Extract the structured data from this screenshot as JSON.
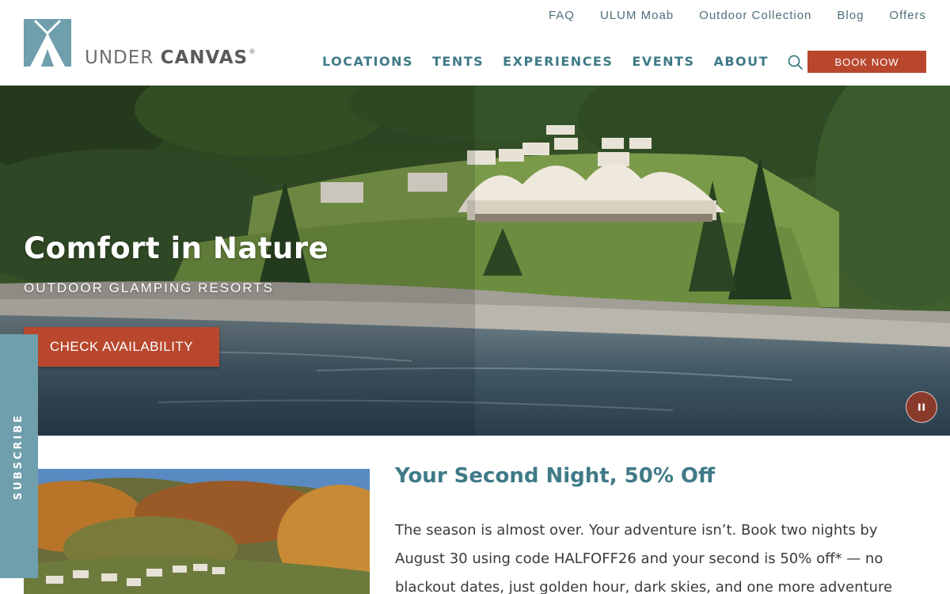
{
  "brand": {
    "name_part1": "UNDER ",
    "name_part2": "CANVAS",
    "mark": "®",
    "colors": {
      "teal": "#3f7a87",
      "slate": "#6f9eac",
      "rust": "#b9472e"
    }
  },
  "utility_nav": [
    {
      "label": "FAQ"
    },
    {
      "label": "ULUM Moab"
    },
    {
      "label": "Outdoor Collection"
    },
    {
      "label": "Blog"
    },
    {
      "label": "Offers"
    }
  ],
  "main_nav": [
    {
      "label": "LOCATIONS"
    },
    {
      "label": "TENTS"
    },
    {
      "label": "EXPERIENCES"
    },
    {
      "label": "EVENTS"
    },
    {
      "label": "ABOUT"
    }
  ],
  "icons": {
    "search": "search-icon",
    "pause": "pause-icon"
  },
  "header": {
    "book_now_label": "BOOK NOW"
  },
  "hero": {
    "title": "Comfort in Nature",
    "subtitle": "OUTDOOR GLAMPING RESORTS",
    "cta_label": "CHECK AVAILABILITY"
  },
  "subscribe": {
    "label": "SUBSCRIBE"
  },
  "promo": {
    "title": "Your Second Night, 50% Off",
    "body": "The season is almost over. Your adventure isn’t. Book two nights by August 30 using code HALFOFF26 and your second is 50% off* — no blackout dates, just golden hour, dark skies, and one more adventure"
  }
}
